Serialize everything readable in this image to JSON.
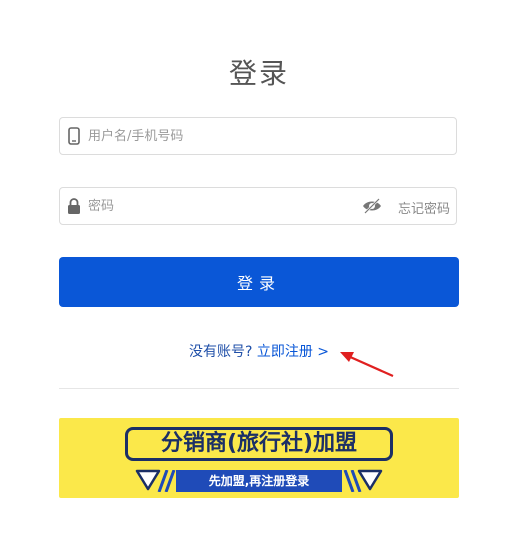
{
  "page": {
    "title": "登录"
  },
  "form": {
    "username_placeholder": "用户名/手机号码",
    "password_placeholder": "密码",
    "forgot_label": "忘记密码",
    "login_label": "登录"
  },
  "register": {
    "question": "没有账号?",
    "link": "立即注册 >"
  },
  "banner": {
    "headline": "分销商(旅行社)加盟",
    "subline": "先加盟,再注册登录"
  },
  "colors": {
    "primary": "#0a57d7",
    "banner_bg": "#fbe84a",
    "banner_navy": "#1b2f66",
    "annotation_arrow": "#e02020"
  }
}
